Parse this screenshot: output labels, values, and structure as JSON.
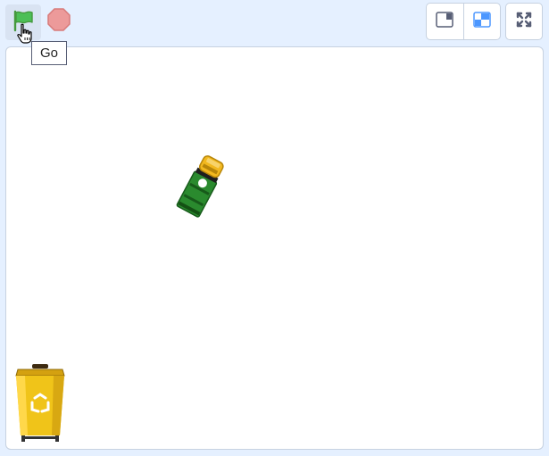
{
  "toolbar": {
    "green_flag": {
      "icon": "green-flag-icon",
      "tooltip": "Go",
      "color": "#4cbf56"
    },
    "stop": {
      "icon": "stop-sign-icon",
      "color": "#ec5959"
    },
    "layout_buttons": [
      {
        "icon": "small-stage-icon",
        "active": false
      },
      {
        "icon": "large-stage-icon",
        "active": true
      }
    ],
    "fullscreen": {
      "icon": "fullscreen-icon"
    }
  },
  "stage": {
    "sprites": [
      {
        "name": "truck",
        "icon": "garbage-truck-sprite",
        "colors": {
          "body": "#2a8a2e",
          "cab": "#f2b81f"
        }
      },
      {
        "name": "recycle-bin",
        "icon": "recycle-bin-sprite",
        "colors": {
          "body": "#f0c419",
          "lid": "#d4a110"
        }
      }
    ]
  },
  "colors": {
    "background": "#e5f0ff",
    "accent": "#4c97ff",
    "border": "#c6d1e0"
  }
}
